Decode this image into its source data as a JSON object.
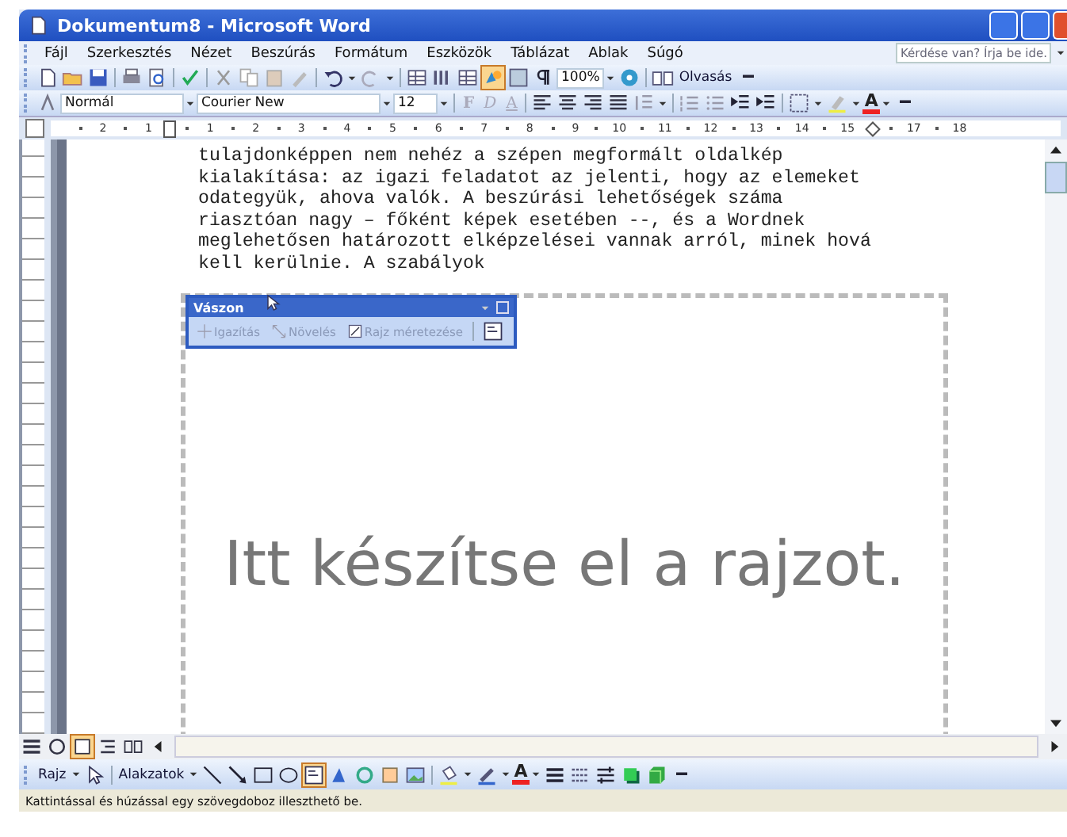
{
  "window": {
    "title": "Dokumentum8 - Microsoft Word"
  },
  "menu": [
    "Fájl",
    "Szerkesztés",
    "Nézet",
    "Beszúrás",
    "Formátum",
    "Eszközök",
    "Táblázat",
    "Ablak",
    "Súgó"
  ],
  "help_field": {
    "placeholder": "Kérdése van? Írja be ide."
  },
  "standard_toolbar": {
    "drawing_selected": true,
    "zoom": "100%",
    "reading_button": "Olvasás"
  },
  "formatting_toolbar": {
    "style": "Normál",
    "font": "Courier New",
    "size": "12",
    "format_buttons": [
      "F",
      "D",
      "A"
    ],
    "font_color_label": "A"
  },
  "ruler": {
    "labels": [
      "2",
      "1",
      "1",
      "2",
      "3",
      "4",
      "5",
      "6",
      "7",
      "8",
      "9",
      "10",
      "11",
      "12",
      "13",
      "14",
      "15",
      "17",
      "18"
    ]
  },
  "document": {
    "lines": [
      "tulajdonképpen nem nehéz a szépen megformált oldalkép",
      "kialakítása: az igazi feladatot az jelenti, hogy az elemeket",
      "odategyük, ahova valók. A beszúrási lehetőségek száma",
      "riasztóan nagy – főként képek esetében --, és a Wordnek",
      "meglehetősen határozott elképzelései vannak arról, minek hová",
      "kell kerülnie. A szabályok"
    ],
    "canvas": {
      "placeholder": "Itt készítse el a rajzot."
    }
  },
  "canvas_toolbar": {
    "title": "Vászon",
    "buttons": [
      "Igazítás",
      "Növelés",
      "Rajz méretezése"
    ]
  },
  "view_buttons": [
    {
      "selected": false
    },
    {
      "selected": false
    },
    {
      "selected": true
    },
    {
      "selected": false
    },
    {
      "selected": false
    }
  ],
  "drawing_toolbar": {
    "draw_menu": "Rajz",
    "shapes_menu": "Alakzatok",
    "textbox_selected": true,
    "font_color_label": "A"
  },
  "status_bar": {
    "text": "Kattintással és húzással egy szövegdoboz illeszthető be."
  }
}
